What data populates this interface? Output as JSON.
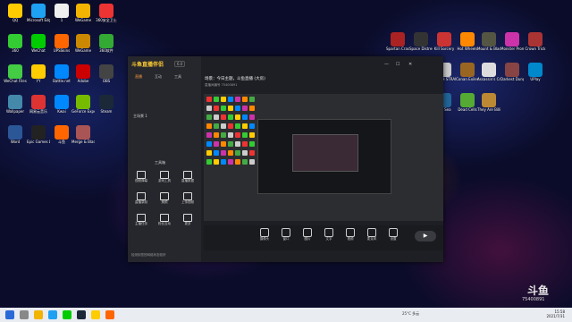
{
  "desktop": {
    "left_icons": [
      {
        "label": "QQ",
        "color": "#ffcc00"
      },
      {
        "label": "Microsoft Edge",
        "color": "#1ea1f2"
      },
      {
        "label": "1",
        "color": "#eee"
      },
      {
        "label": "WeGame",
        "color": "#f2b400"
      },
      {
        "label": "360安全卫士",
        "color": "#e33"
      },
      {
        "label": "360",
        "color": "#3c3"
      },
      {
        "label": "WeChat",
        "color": "#0c0"
      },
      {
        "label": "UPSSkins",
        "color": "#f60"
      },
      {
        "label": "WeGame",
        "color": "#c80"
      },
      {
        "label": "360软件",
        "color": "#3a3"
      },
      {
        "label": "WeChat Files",
        "color": "#4c4"
      },
      {
        "label": "YY",
        "color": "#fc0"
      },
      {
        "label": "Battle.net",
        "color": "#08f"
      },
      {
        "label": "Adobe",
        "color": "#c00"
      },
      {
        "label": "OBS",
        "color": "#444"
      },
      {
        "label": "Wallpaper",
        "color": "#48a"
      },
      {
        "label": "网易云音乐",
        "color": "#d33"
      },
      {
        "label": "Kwai",
        "color": "#08f"
      },
      {
        "label": "GeForce Experience",
        "color": "#7b0"
      },
      {
        "label": "Steam",
        "color": "#1b2838"
      },
      {
        "label": "Word",
        "color": "#2b5797"
      },
      {
        "label": "Epic Games Launcher",
        "color": "#222"
      },
      {
        "label": "斗鱼",
        "color": "#f60"
      },
      {
        "label": "Merge & Blade",
        "color": "#a55"
      }
    ],
    "right_icons": [
      {
        "label": "Spartan Crash",
        "color": "#a22"
      },
      {
        "label": "Space Distress",
        "color": "#333"
      },
      {
        "label": "Kill Sorcery",
        "color": "#c33"
      },
      {
        "label": "Hot Wheels",
        "color": "#f80"
      },
      {
        "label": "Mount & Blade II",
        "color": "#554"
      },
      {
        "label": "Monster Prom",
        "color": "#c3a"
      },
      {
        "label": "Crown Trick",
        "color": "#a33"
      },
      {
        "label": "Death Trash",
        "color": "#663"
      },
      {
        "label": "Hades",
        "color": "#b22"
      },
      {
        "label": "DEATH STRANDING",
        "color": "#ccc"
      },
      {
        "label": "Conan Exiles",
        "color": "#962"
      },
      {
        "label": "Assassin's Creed",
        "color": "#ddd"
      },
      {
        "label": "Darkest Dungeon",
        "color": "#844"
      },
      {
        "label": "UPlay",
        "color": "#08c"
      },
      {
        "label": "Inside",
        "color": "#222"
      },
      {
        "label": "FTL Faster Than Light",
        "color": "#4a4"
      },
      {
        "label": "Big Sea",
        "color": "#269"
      },
      {
        "label": "Dead Cells",
        "color": "#5a3"
      },
      {
        "label": "They Are Billions",
        "color": "#b83"
      }
    ]
  },
  "app": {
    "logo": "斗鱼直播伴侣",
    "version": "6.0",
    "side_tabs": [
      "直播",
      "互动",
      "工具"
    ],
    "scene_label": "主场景 1",
    "stream_title": "场景：今日主题，斗鱼直播 (大房)",
    "stream_subtitle": "直播间编号 75400891",
    "tools_heading": "工具箱",
    "tools": [
      {
        "label": "视频弹幕",
        "name": "danmu"
      },
      {
        "label": "游戏工具",
        "name": "game-tool"
      },
      {
        "label": "直播数据",
        "name": "live-data"
      },
      {
        "label": "直播录制",
        "name": "recording"
      },
      {
        "label": "美颜",
        "name": "beauty"
      },
      {
        "label": "上传视频",
        "name": "upload"
      },
      {
        "label": "主播任务",
        "name": "tasks"
      },
      {
        "label": "粉丝互动",
        "name": "fans"
      },
      {
        "label": "更多",
        "name": "more"
      }
    ],
    "footer_notice": "检测到您的网络状态较好",
    "controls": [
      {
        "label": "摄像头",
        "name": "camera"
      },
      {
        "label": "窗口",
        "name": "window"
      },
      {
        "label": "图片",
        "name": "image"
      },
      {
        "label": "文字",
        "name": "text"
      },
      {
        "label": "视频",
        "name": "video"
      },
      {
        "label": "麦克风",
        "name": "mic"
      },
      {
        "label": "设置",
        "name": "settings"
      }
    ],
    "start_button": "▶"
  },
  "overlay": {
    "logo": "斗鱼",
    "room_id": "75400891"
  },
  "taskbar": {
    "weather": "25°C 多云",
    "time": "15:58",
    "date": "2021/7/31"
  }
}
